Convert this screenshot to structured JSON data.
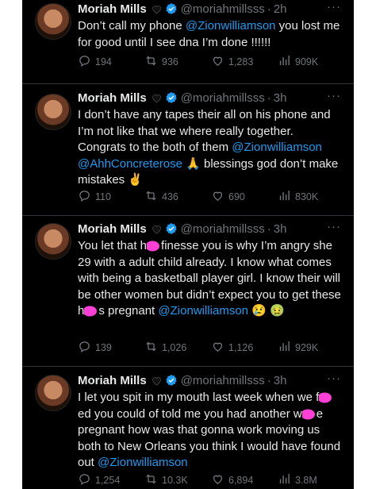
{
  "tweets": [
    {
      "name": "Moriah Mills",
      "handle": "@moriahmillsss",
      "time": "2h",
      "text": [
        {
          "t": "Don’t call my phone "
        },
        {
          "t": "@Zionwilliamson",
          "m": true
        },
        {
          "t": " you lost me for good until I see dna I’m done !!!!!!"
        }
      ],
      "replies": "194",
      "retweets": "936",
      "likes": "1,283",
      "views": "909K"
    },
    {
      "name": "Moriah Mills",
      "handle": "@moriahmillsss",
      "time": "3h",
      "text": [
        {
          "t": "I don’t have any tapes their all on his phone and I’m not like that we where really together. Congrats to the both of them "
        },
        {
          "t": "@Zionwilliamson",
          "m": true
        },
        {
          "t": " "
        },
        {
          "t": "@AhhConcreterose",
          "m": true
        },
        {
          "t": " 🙏 blessings god don’t make mistakes ✌️"
        }
      ],
      "replies": "110",
      "retweets": "436",
      "likes": "690",
      "views": "830K"
    },
    {
      "name": "Moriah Mills",
      "handle": "@moriahmillsss",
      "time": "3h",
      "text": [
        {
          "t": "You let that h"
        },
        {
          "s": true
        },
        {
          "t": "finesse you is why I’m angry she 29 with a adult child already. I know what comes with being a basketball player girl. I know their will be other women but didn’t expect you to get these h"
        },
        {
          "s": true
        },
        {
          "t": "s pregnant "
        },
        {
          "t": "@Zionwilliamson",
          "m": true
        },
        {
          "t": " 😢 🤢"
        }
      ],
      "replies": "139",
      "retweets": "1,026",
      "likes": "1,126",
      "views": "929K"
    },
    {
      "name": "Moriah Mills",
      "handle": "@moriahmillsss",
      "time": "3h",
      "text": [
        {
          "t": "I let you spit in my mouth last week when we f"
        },
        {
          "s": true
        },
        {
          "t": "ed you could of told me you had another w"
        },
        {
          "s": true
        },
        {
          "t": "e pregnant how was that gonna work moving us both to New Orleans you think I would have found out "
        },
        {
          "t": "@Zionwilliamson",
          "m": true
        }
      ],
      "replies": "1,254",
      "retweets": "10.3K",
      "likes": "6,894",
      "views": "3.8M"
    }
  ],
  "icons": {
    "heart_emoji": "black-heart-icon",
    "verified": "verified-badge-icon",
    "more": "more-options-icon",
    "reply": "reply-icon",
    "retweet": "retweet-icon",
    "like": "like-icon",
    "views": "views-icon",
    "share": "share-icon"
  },
  "colors": {
    "background": "#000000",
    "text": "#e7e9ea",
    "muted": "#71767b",
    "link": "#1d9bf0",
    "censor": "#ff3fd5"
  },
  "ui": {
    "dot": "·",
    "more": "···"
  }
}
